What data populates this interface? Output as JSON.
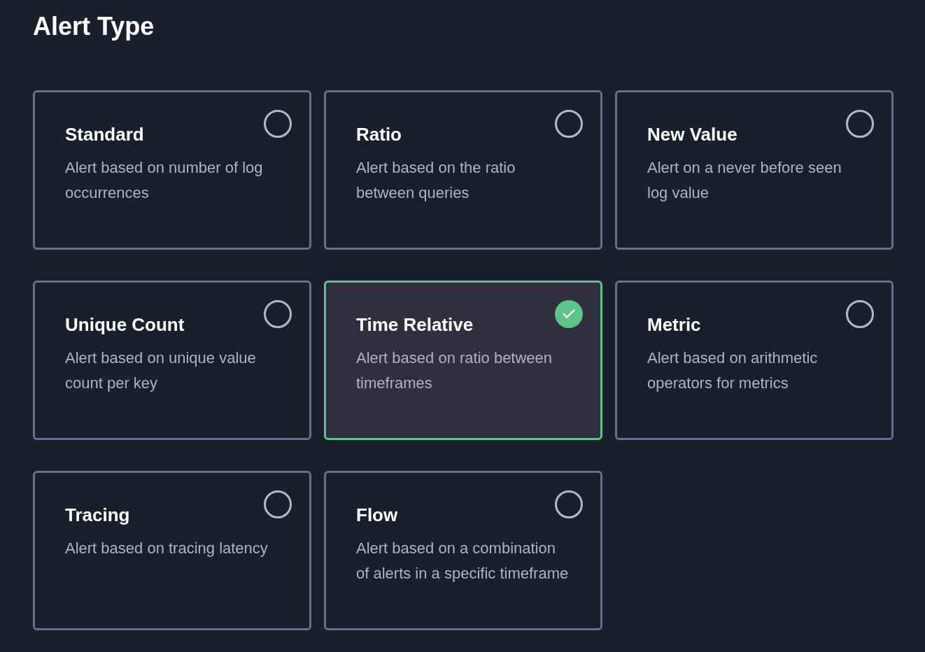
{
  "title": "Alert Type",
  "options": [
    {
      "name": "Standard",
      "description": "Alert based on number of log occurrences",
      "selected": false
    },
    {
      "name": "Ratio",
      "description": "Alert based on the ratio between queries",
      "selected": false
    },
    {
      "name": "New Value",
      "description": "Alert on a never before seen log value",
      "selected": false
    },
    {
      "name": "Unique Count",
      "description": "Alert based on unique value count per key",
      "selected": false
    },
    {
      "name": "Time Relative",
      "description": "Alert based on ratio between timeframes",
      "selected": true
    },
    {
      "name": "Metric",
      "description": "Alert based on arithmetic operators for metrics",
      "selected": false
    },
    {
      "name": "Tracing",
      "description": "Alert based on tracing latency",
      "selected": false
    },
    {
      "name": "Flow",
      "description": "Alert based on a combination of alerts in a specific timeframe",
      "selected": false
    }
  ]
}
